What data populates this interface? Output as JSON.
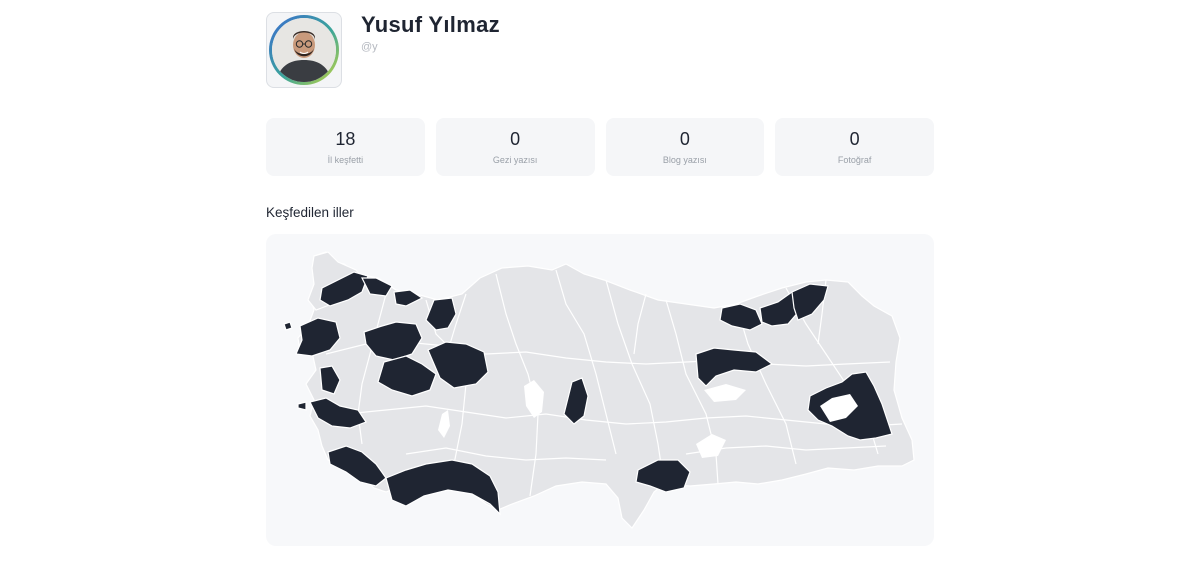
{
  "profile": {
    "name": "Yusuf Yılmaz",
    "handle": "@y"
  },
  "stats": [
    {
      "value": "18",
      "label": "İl keşfetti"
    },
    {
      "value": "0",
      "label": "Gezi yazısı"
    },
    {
      "value": "0",
      "label": "Blog yazısı"
    },
    {
      "value": "0",
      "label": "Fotoğraf"
    }
  ],
  "map_section": {
    "title": "Keşfedilen iller"
  },
  "colors": {
    "visited": "#1f2532",
    "unvisited": "#e4e5e8",
    "border": "#ffffff",
    "card_bg": "#f7f8fa"
  }
}
